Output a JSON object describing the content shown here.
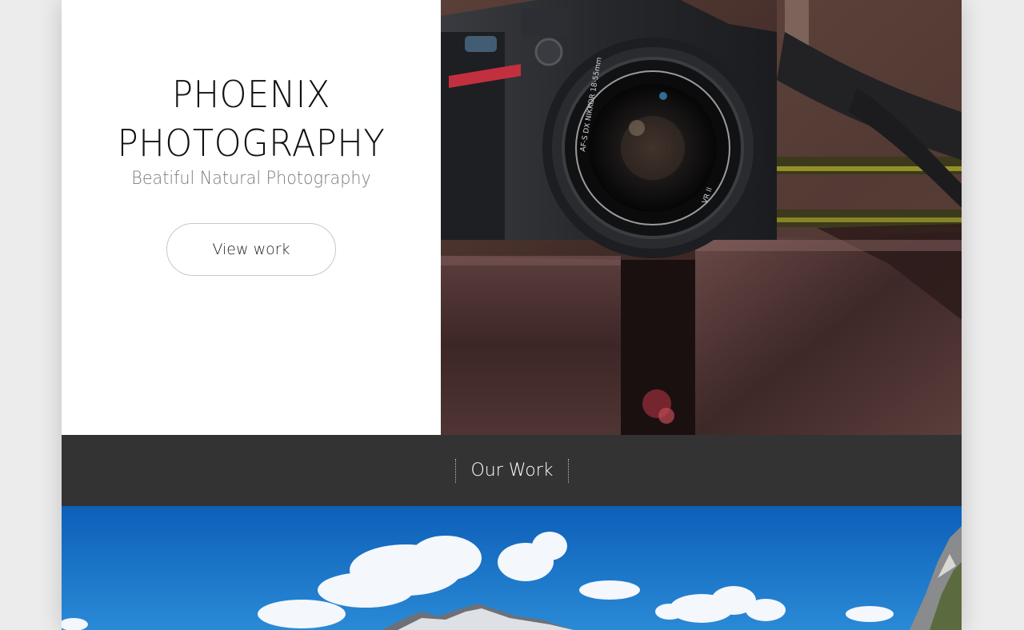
{
  "hero": {
    "title_line1": "PHOENIX",
    "title_line2": "PHOTOGRAPHY",
    "subtitle": "Beatiful Natural Photography",
    "cta_label": "View work",
    "lens_text_left": "AF-S DX NIKKOR 18-55mm",
    "lens_text_right": "VR II"
  },
  "work_section": {
    "heading": "Our Work"
  },
  "colors": {
    "dark_bar": "#333333",
    "page_background": "#ececec",
    "title_text": "#111111",
    "subtitle_text": "#7a7a7a",
    "sky": "#1a74c9"
  }
}
